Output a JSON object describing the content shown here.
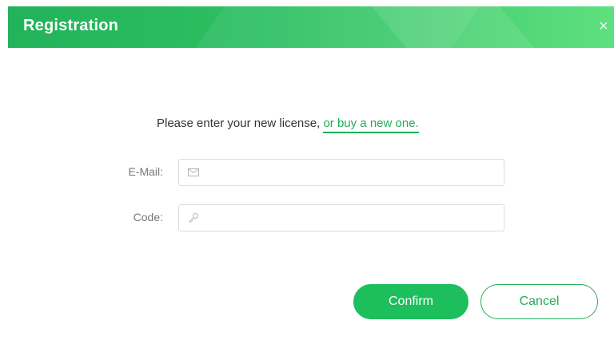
{
  "window": {
    "title": "Registration",
    "close_glyph": "×"
  },
  "prompt": {
    "text": "Please enter your new license, ",
    "link": "or buy a new one."
  },
  "form": {
    "email_label": "E-Mail:",
    "email_value": "",
    "email_icon": "envelope-icon",
    "code_label": "Code:",
    "code_value": "",
    "code_icon": "key-icon"
  },
  "buttons": {
    "confirm": "Confirm",
    "cancel": "Cancel"
  },
  "colors": {
    "accent": "#1dbe5c",
    "title_gradient_start": "#22b35a",
    "title_gradient_end": "#5fe07f"
  }
}
